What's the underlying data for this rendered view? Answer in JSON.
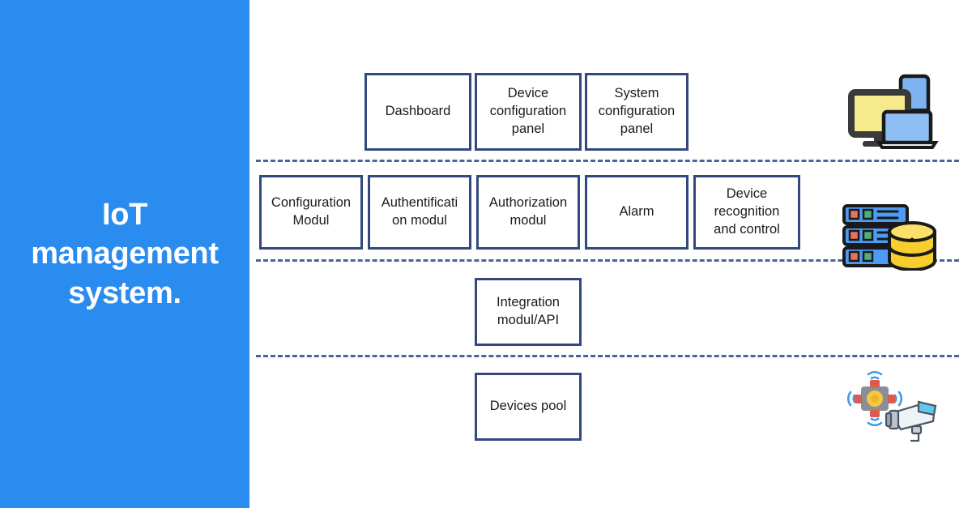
{
  "title_panel": {
    "heading": "IoT\nmanagement\nsystem.",
    "background_color": "#2B8CF0",
    "text_color": "#FFFFFF"
  },
  "theme": {
    "box_border_color": "#31497C",
    "divider_color": "#4A639B",
    "box_fill": "#FFFFFF",
    "canvas": "#FFFFFF"
  },
  "diagram": {
    "layers": [
      {
        "name": "presentation-layer",
        "nodes": [
          {
            "label": "Dashboard"
          },
          {
            "label": "Device\nconfiguration\npanel"
          },
          {
            "label": "System\nconfiguration\npanel"
          }
        ],
        "icon": {
          "name": "devices-icon",
          "caption": "monitor-tablet-laptop"
        }
      },
      {
        "name": "module-layer",
        "nodes": [
          {
            "label": "Configuration\nModul"
          },
          {
            "label": "Authentificati\non modul"
          },
          {
            "label": "Authorization\nmodul"
          },
          {
            "label": "Alarm"
          },
          {
            "label": "Device\nrecognition\nand control"
          }
        ],
        "icon": {
          "name": "server-database-icon",
          "caption": "server-rack-and-database"
        }
      },
      {
        "name": "integration-layer",
        "nodes": [
          {
            "label": "Integration\nmodul/API"
          }
        ],
        "icon": null
      },
      {
        "name": "device-layer",
        "nodes": [
          {
            "label": "Devices pool"
          }
        ],
        "icon": {
          "name": "iot-sensor-camera-icon",
          "caption": "wireless-sensor-and-security-camera"
        }
      }
    ],
    "dividers": 3
  },
  "icon_colors": {
    "monitor_frame": "#3A3A3A",
    "monitor_screen": "#F7E98E",
    "device_blue": "#7FB2F0",
    "server_blue": "#4E9BF5",
    "database_yellow": "#F7CE2B",
    "outline_dark": "#1A1A1A",
    "sensor_gray": "#8A8F96",
    "sensor_red": "#E05A4B",
    "sensor_yellow": "#F5C843",
    "wave_blue": "#3D9BE9",
    "camera_body": "#E8EDF2",
    "camera_glass": "#63C6EE"
  }
}
